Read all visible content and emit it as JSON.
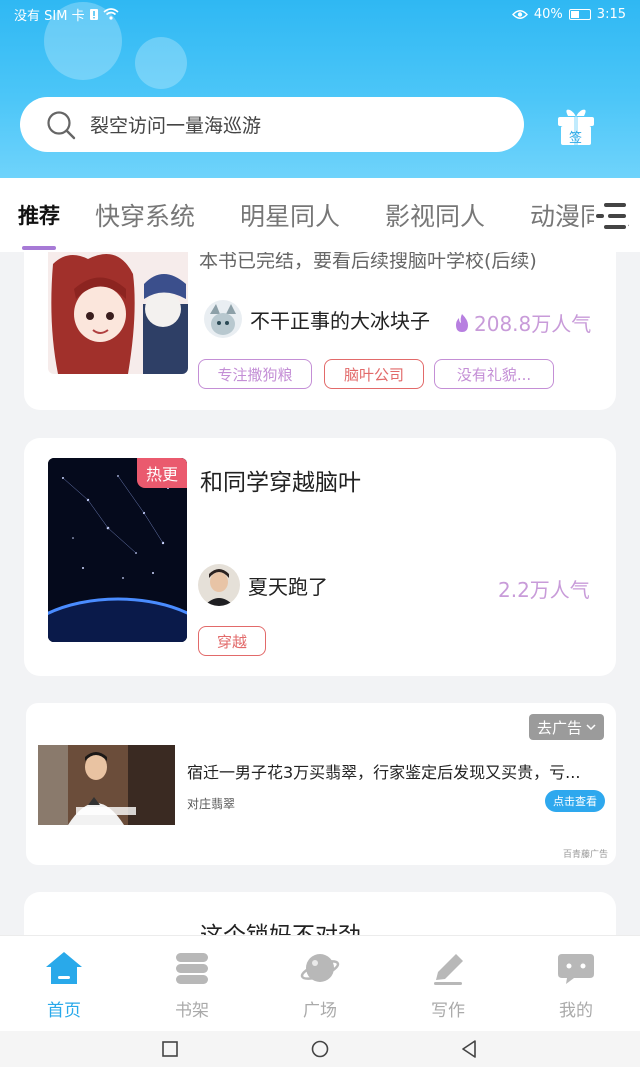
{
  "status_bar": {
    "carrier": "没有 SIM 卡",
    "battery": "40%",
    "time": "3:15"
  },
  "search": {
    "placeholder": "裂空访问一量海巡游",
    "checkin_label": "签"
  },
  "tabs": [
    {
      "label": "推荐",
      "active": true
    },
    {
      "label": "快穿系统",
      "active": false
    },
    {
      "label": "明星同人",
      "active": false
    },
    {
      "label": "影视同人",
      "active": false
    },
    {
      "label": "动漫同人",
      "active": false
    }
  ],
  "feed": [
    {
      "title": "本书已完结，要看后续搜脑叶学校(后续)",
      "author": "不干正事的大冰块子",
      "popularity": "208.8万人气",
      "tags": [
        {
          "label": "专注撒狗粮",
          "color": "#c48fd6"
        },
        {
          "label": "脑叶公司",
          "color": "#e26a6a"
        },
        {
          "label": "没有礼貌...",
          "color": "#c48fd6"
        }
      ]
    },
    {
      "title": "和同学穿越脑叶",
      "badge": "热更",
      "author": "夏天跑了",
      "popularity": "2.2万人气",
      "tags": [
        {
          "label": "穿越",
          "color": "#e26a6a"
        }
      ]
    },
    {
      "title": "这个锁妈不对劲"
    }
  ],
  "ad": {
    "badge": "去广告",
    "title": "宿迁一男子花3万买翡翠，行家鉴定后发现又买贵，亏...",
    "source": "对庄翡翠",
    "button": "点击查看",
    "footnote": "百青藤广告"
  },
  "bottom_nav": [
    {
      "label": "首页",
      "icon": "home-icon",
      "active": true
    },
    {
      "label": "书架",
      "icon": "bookshelf-icon",
      "active": false
    },
    {
      "label": "广场",
      "icon": "planet-icon",
      "active": false
    },
    {
      "label": "写作",
      "icon": "pen-icon",
      "active": false
    },
    {
      "label": "我的",
      "icon": "chat-bubble-icon",
      "active": false
    }
  ],
  "colors": {
    "brand_blue": "#2fb8f3",
    "nav_active": "#29a9ea",
    "popularity": "#c89bd9",
    "hot_badge": "#ea5a6e"
  }
}
